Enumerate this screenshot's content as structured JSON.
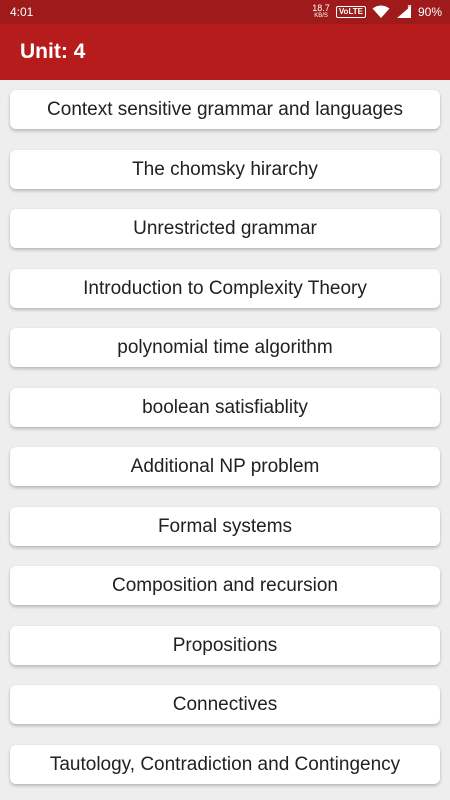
{
  "status_bar": {
    "time": "4:01",
    "network_speed": "18.7",
    "network_speed_unit": "KB/S",
    "volte": "VoLTE",
    "battery": "90%"
  },
  "app_bar": {
    "title": "Unit: 4",
    "color": "#b71c1c"
  },
  "topics": [
    "Context sensitive grammar and languages",
    "The chomsky hirarchy",
    "Unrestricted grammar",
    "Introduction to Complexity Theory",
    "polynomial time algorithm",
    "boolean satisfiablity",
    "Additional NP problem",
    "Formal systems",
    "Composition and recursion",
    "Propositions",
    "Connectives",
    "Tautology, Contradiction and Contingency"
  ]
}
